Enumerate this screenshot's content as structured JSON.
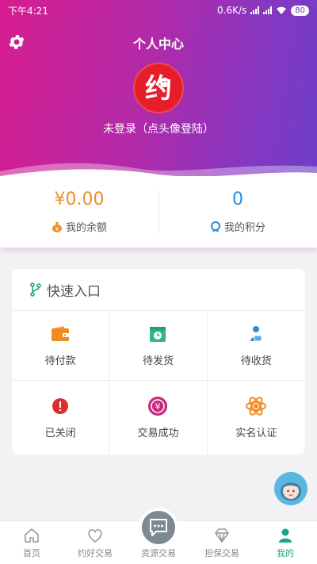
{
  "status_bar": {
    "time": "下午4:21",
    "network_speed": "0.6K/s",
    "battery": "80"
  },
  "header": {
    "title": "个人中心",
    "login_prompt": "未登录（点头像登陆）",
    "avatar_char": "约"
  },
  "stats": {
    "balance_value": "¥0.00",
    "balance_label": "我的余额",
    "points_value": "0",
    "points_label": "我的积分"
  },
  "quick_entry": {
    "title": "快速入口",
    "items": [
      {
        "label": "待付款",
        "icon": "wallet-icon",
        "color": "#f08a22"
      },
      {
        "label": "待发货",
        "icon": "clock-box-icon",
        "color": "#2fb68a"
      },
      {
        "label": "待收货",
        "icon": "delivery-person-icon",
        "color": "#2a8ed8"
      },
      {
        "label": "已关闭",
        "icon": "alert-icon",
        "color": "#e02d2d"
      },
      {
        "label": "交易成功",
        "icon": "yen-coin-icon",
        "color": "#c62a7e"
      },
      {
        "label": "实名认证",
        "icon": "atom-icon",
        "color": "#f08a22"
      }
    ]
  },
  "bottom_nav": {
    "items": [
      {
        "label": "首页",
        "icon": "home-icon"
      },
      {
        "label": "约好交易",
        "icon": "heart-icon"
      },
      {
        "label": "资源交易",
        "icon": "chat-icon"
      },
      {
        "label": "担保交易",
        "icon": "diamond-icon"
      },
      {
        "label": "我的",
        "icon": "user-icon"
      }
    ],
    "active_index": 4
  },
  "colors": {
    "accent": "#1aa58a",
    "header_start": "#d61d8f",
    "header_end": "#6d3fc9"
  }
}
